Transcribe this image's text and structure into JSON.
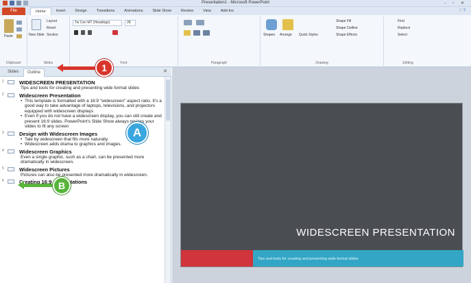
{
  "window": {
    "title": "Presentation1 - Microsoft PowerPoint",
    "controls": "- ▫ ✕"
  },
  "ribbon_tabs": {
    "file": "File",
    "tabs": [
      "Home",
      "Insert",
      "Design",
      "Transitions",
      "Animations",
      "Slide Show",
      "Review",
      "View",
      "Add-Ins"
    ],
    "help": "♡ ?"
  },
  "ribbon": {
    "clipboard": {
      "label": "Clipboard",
      "paste": "Paste"
    },
    "slides": {
      "label": "Slides",
      "new_slide": "New Slide",
      "layout": "Layout",
      "reset": "Reset",
      "section": "Section"
    },
    "font": {
      "label": "Font",
      "font_name": "Tw Cen MT (Headings)",
      "font_size": "28"
    },
    "paragraph": {
      "label": "Paragraph"
    },
    "drawing": {
      "label": "Drawing",
      "shapes": "Shapes",
      "arrange": "Arrange",
      "quick_styles": "Quick Styles",
      "shape_fill": "Shape Fill",
      "shape_outline": "Shape Outline",
      "shape_effects": "Shape Effects"
    },
    "editing": {
      "label": "Editing",
      "find": "Find",
      "replace": "Replace",
      "select": "Select"
    }
  },
  "panel": {
    "tab_slides": "Slides",
    "tab_outline": "Outline",
    "close": "✕"
  },
  "outline": [
    {
      "num": "1",
      "title": "WIDESCREEN PRESENTATION",
      "lines": [
        "Tips and tools for creating and presenting wide format slides"
      ]
    },
    {
      "num": "2",
      "title": "Widescreen Presentation",
      "bullets": [
        "This template is formatted with a 16:9 \"widescreen\" aspect ratio. It's a good way to take advantage of laptops, televisions, and projectors equipped with widescreen displays",
        "Even if you do not have a widescreen display, you can still create and present 16:9 slides. PowerPoint's Slide Show always resizes your slides to fit any screen"
      ]
    },
    {
      "num": "3",
      "title": "Design with Widescreen Images",
      "bullets": [
        "Tale by widescreen that fits more naturally.",
        "Widescreen adds drama to graphics and images."
      ]
    },
    {
      "num": "4",
      "title": "Widescreen Graphics",
      "lines": [
        "Even a single graphic, such as a chart, can be presented more dramatically in widescreen."
      ]
    },
    {
      "num": "5",
      "title": "Widescreen Pictures",
      "lines": [
        "Pictures can also be presented more dramatically in widescreen."
      ]
    },
    {
      "num": "6",
      "title": "Creating 16:9 Presentations",
      "lines": []
    }
  ],
  "slide": {
    "title": "WIDESCREEN PRESENTATION",
    "subtitle": "Tips and tools for creating and presenting wide format slides",
    "colors": {
      "background": "#4a4e52",
      "red_bar": "#d1343b",
      "blue_bar": "#33a6c5"
    }
  },
  "callouts": {
    "one": "1",
    "a": "A",
    "b": "B",
    "colors": {
      "one": "#d9342b",
      "a": "#3aa6df",
      "b": "#58b43b"
    }
  }
}
